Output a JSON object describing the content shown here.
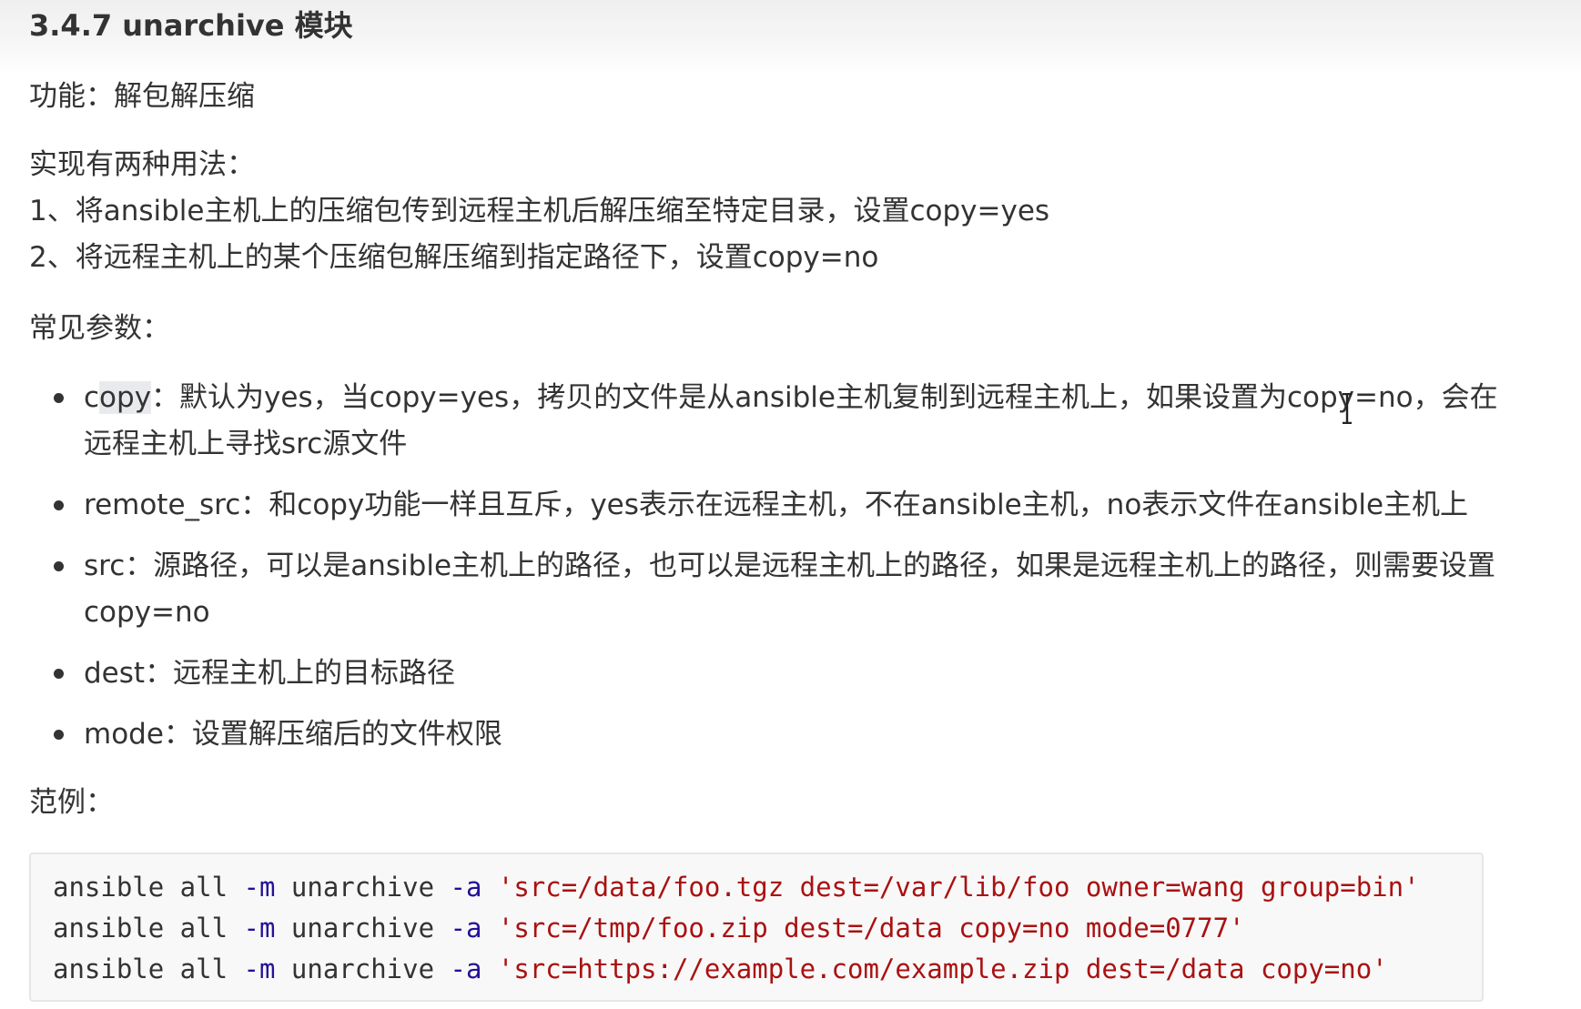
{
  "heading": "3.4.7 unarchive 模块",
  "function_line": "功能：解包解压缩",
  "usage": {
    "intro": "实现有两种用法：",
    "items": [
      "1、将ansible主机上的压缩包传到远程主机后解压缩至特定目录，设置copy=yes",
      "2、将远程主机上的某个压缩包解压缩到指定路径下，设置copy=no"
    ]
  },
  "params_label": "常见参数：",
  "params": [
    {
      "name_pre": "c",
      "name_highlight": "opy",
      "desc": "：默认为yes，当copy=yes，拷贝的文件是从ansible主机复制到远程主机上，如果设置为copy=no，会在远程主机上寻找src源文件"
    },
    {
      "name": "remote_src",
      "desc": "：和copy功能一样且互斥，yes表示在远程主机，不在ansible主机，no表示文件在ansible主机上"
    },
    {
      "name": "src",
      "desc": "：源路径，可以是ansible主机上的路径，也可以是远程主机上的路径，如果是远程主机上的路径，则需要设置copy=no"
    },
    {
      "name": "dest",
      "desc": "：远程主机上的目标路径"
    },
    {
      "name": "mode",
      "desc": "：设置解压缩后的文件权限"
    }
  ],
  "example_label": "范例：",
  "code_lines": [
    {
      "cmd": "ansible all ",
      "opt_m": "-m",
      "module": " unarchive ",
      "opt_a": "-a",
      "sep": " ",
      "args": "'src=/data/foo.tgz dest=/var/lib/foo owner=wang group=bin'"
    },
    {
      "cmd": "ansible all ",
      "opt_m": "-m",
      "module": " unarchive ",
      "opt_a": "-a",
      "sep": " ",
      "args": "'src=/tmp/foo.zip dest=/data copy=no mode=0777'"
    },
    {
      "cmd": "ansible all ",
      "opt_m": "-m",
      "module": " unarchive ",
      "opt_a": "-a",
      "sep": " ",
      "args": "'src=https://example.com/example.zip dest=/data copy=no'"
    }
  ],
  "colors": {
    "text": "#333333",
    "code_flag": "#221199",
    "code_string": "#aa1111",
    "code_background": "#f8f8f8",
    "highlight": "#e9eaee"
  },
  "icons": {
    "cursor": "text-cursor-icon"
  }
}
